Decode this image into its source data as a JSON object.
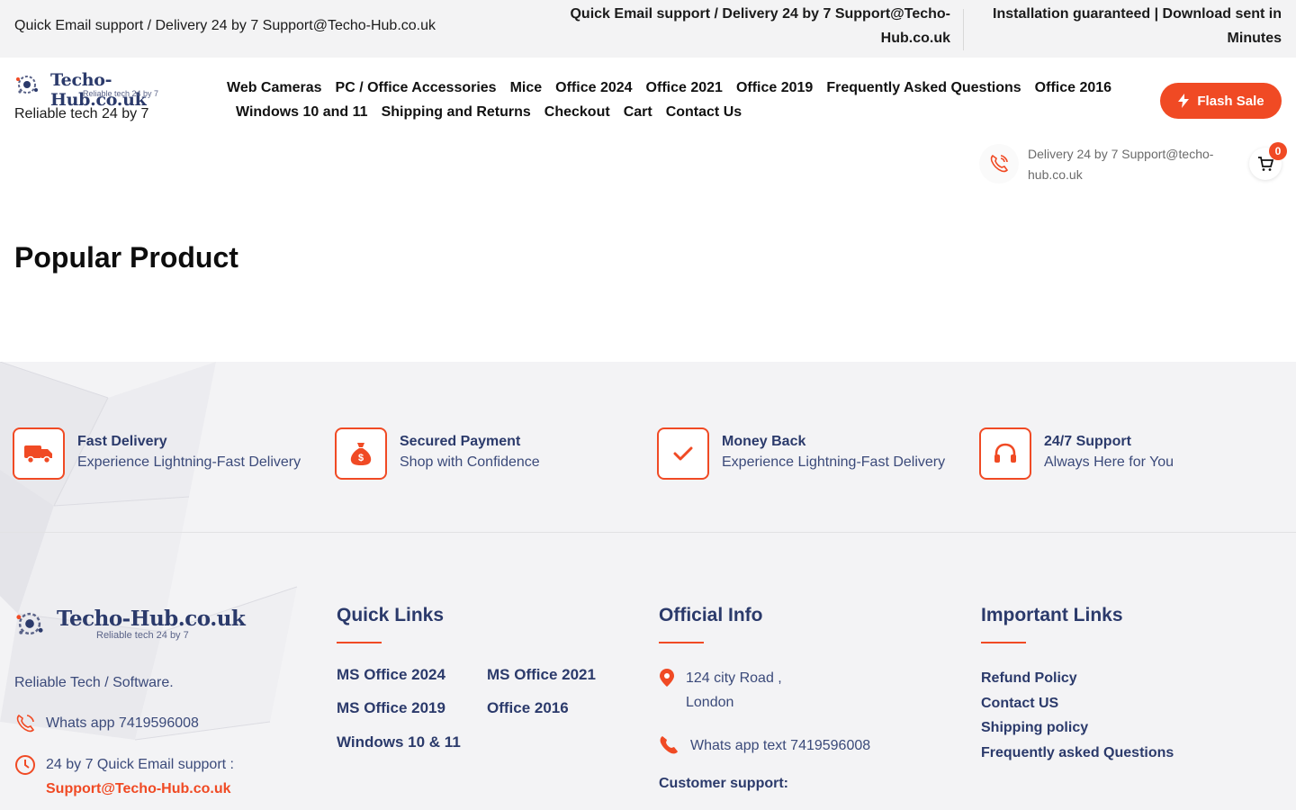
{
  "topbar": {
    "left_text": "Quick Email support / Delivery 24 by 7 Support@Techo-Hub.co.uk",
    "mid_text": "Quick Email support / Delivery 24 by 7 Support@Techo-Hub.co.uk",
    "right_text": "Installation guaranteed | Download sent in Minutes"
  },
  "brand": {
    "name": "Techo-Hub.co.uk",
    "tagline_small": "Reliable tech 24 by 7",
    "tagline": "Reliable tech 24 by 7"
  },
  "nav": {
    "row1": [
      "Web Cameras",
      "PC / Office Accessories",
      "Mice",
      "Office 2024",
      "Office 2021",
      "Office 2019",
      "Frequently Asked Questions",
      "Office 2016"
    ],
    "row2": [
      "Windows 10 and 11",
      "Shipping and Returns",
      "Checkout",
      "Cart",
      "Contact Us"
    ]
  },
  "flash_sale": {
    "label": "Flash Sale",
    "icon": "lightning-icon"
  },
  "header_contact": {
    "text": "Delivery 24 by 7 Support@techo-hub.co.uk",
    "icon": "phone-icon"
  },
  "cart": {
    "count": "0",
    "icon": "cart-icon"
  },
  "main": {
    "section_title": "Popular Product"
  },
  "features": [
    {
      "title": "Fast Delivery",
      "subtitle": "Experience Lightning-Fast Delivery",
      "icon": "truck-icon"
    },
    {
      "title": "Secured Payment",
      "subtitle": "Shop with Confidence",
      "icon": "money-bag-icon"
    },
    {
      "title": "Money Back",
      "subtitle": "Experience Lightning-Fast Delivery",
      "icon": "check-icon"
    },
    {
      "title": "24/7 Support",
      "subtitle": "Always Here for You",
      "icon": "headset-icon"
    }
  ],
  "footer": {
    "brand_name": "Techo-Hub.co.uk",
    "brand_tag": "Reliable tech 24 by 7",
    "about": "Reliable Tech / Software.",
    "whatsapp": "Whats app 7419596008",
    "support_label": "24 by 7 Quick Email support :",
    "support_email": "Support@Techo-Hub.co.uk",
    "quick_links_title": "Quick Links",
    "quick_links": [
      "MS Office 2024",
      "MS Office 2021",
      "MS Office 2019",
      "Office 2016",
      "Windows 10 & 11"
    ],
    "official_info_title": "Official Info",
    "address_line1": "124 city Road ,",
    "address_line2": "London",
    "whatsapp_text": "Whats app text 7419596008",
    "customer_support": "Customer support:",
    "important_links_title": "Important Links",
    "important_links": [
      "Refund Policy",
      "Contact US",
      "Shipping policy",
      "Frequently asked Questions"
    ]
  },
  "colors": {
    "accent": "#f04a24",
    "navy": "#2b3a6b",
    "topbar_bg": "#f3f3f4",
    "footer_bg": "#f3f3f5"
  }
}
